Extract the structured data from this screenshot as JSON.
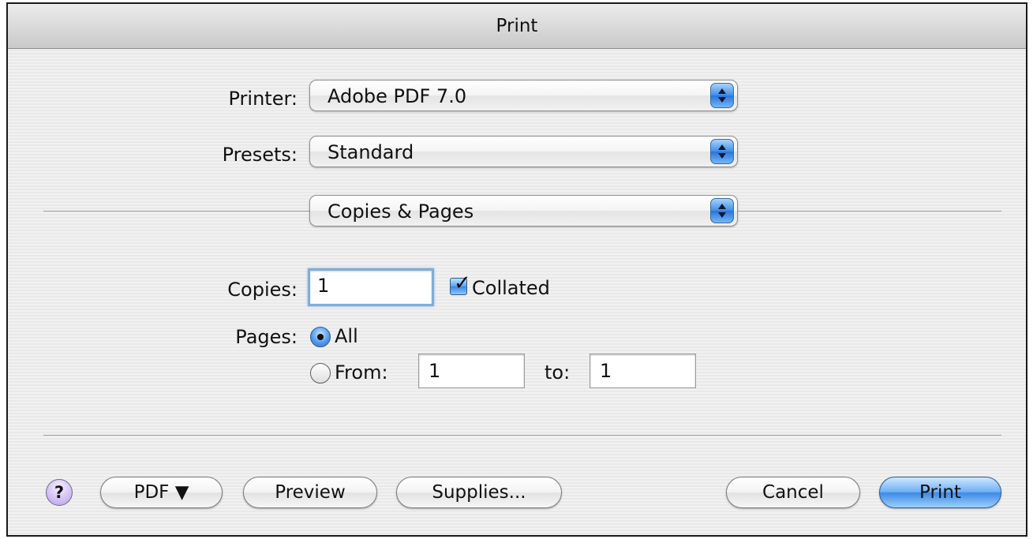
{
  "window": {
    "title": "Print"
  },
  "printer": {
    "label": "Printer:",
    "value": "Adobe PDF 7.0"
  },
  "presets": {
    "label": "Presets:",
    "value": "Standard"
  },
  "panel": {
    "value": "Copies & Pages"
  },
  "copies": {
    "label": "Copies:",
    "value": "1",
    "collated_label": "Collated",
    "collated_checked": true
  },
  "pages": {
    "label": "Pages:",
    "all_label": "All",
    "all_selected": true,
    "from_label": "From:",
    "from_value": "1",
    "to_label": "to:",
    "to_value": "1"
  },
  "buttons": {
    "help": "?",
    "pdf": "PDF ▼",
    "preview": "Preview",
    "supplies": "Supplies...",
    "cancel": "Cancel",
    "print": "Print"
  },
  "colors": {
    "accent": "#3e8ae6",
    "focus_ring": "#7eaed9"
  }
}
